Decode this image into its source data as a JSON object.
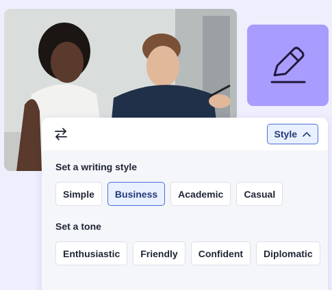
{
  "header": {
    "style_button_label": "Style"
  },
  "writing_style": {
    "title": "Set a writing style",
    "options": [
      "Simple",
      "Business",
      "Academic",
      "Casual"
    ],
    "selected": "Business"
  },
  "tone": {
    "title": "Set a tone",
    "options": [
      "Enthusiastic",
      "Friendly",
      "Confident",
      "Diplomatic"
    ]
  },
  "icons": {
    "pencil": "pencil-icon",
    "swap": "swap-arrows-icon",
    "chevron": "chevron-up-icon"
  },
  "colors": {
    "accent": "#4a6ed6",
    "selected_bg": "#e9f0ff",
    "tile": "#a89cff",
    "page_bg": "#efeefd"
  }
}
